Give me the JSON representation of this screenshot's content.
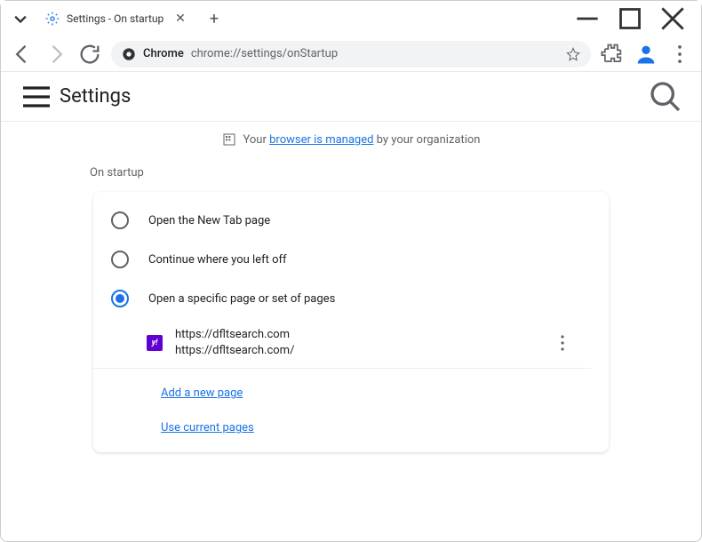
{
  "window": {
    "tab_title": "Settings - On startup"
  },
  "address": {
    "label": "Chrome",
    "url": "chrome://settings/onStartup"
  },
  "header": {
    "title": "Settings"
  },
  "banner": {
    "prefix": "Your ",
    "link": "browser is managed",
    "suffix": " by your organization"
  },
  "section": {
    "title": "On startup"
  },
  "options": {
    "new_tab": "Open the New Tab page",
    "continue": "Continue where you left off",
    "specific": "Open a specific page or set of pages"
  },
  "page_entry": {
    "title": "https://dfltsearch.com",
    "url": "https://dfltsearch.com/"
  },
  "links": {
    "add_page": "Add a new page",
    "use_current": "Use current pages"
  }
}
